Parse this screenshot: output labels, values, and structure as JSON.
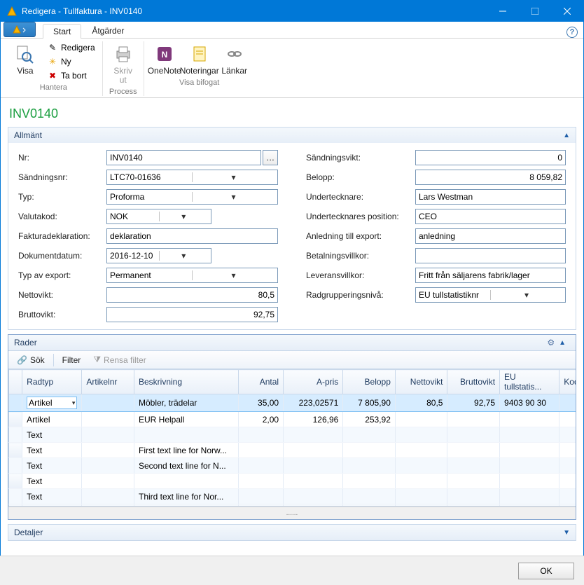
{
  "title": "Redigera - Tullfaktura - INV0140",
  "tabs": {
    "start": "Start",
    "actions": "Åtgärder"
  },
  "ribbon": {
    "visa": "Visa",
    "redigera": "Redigera",
    "ny": "Ny",
    "tabort": "Ta bort",
    "hantera": "Hantera",
    "skrivut_line1": "Skriv",
    "skrivut_line2": "ut",
    "process": "Process",
    "onenote": "OneNote",
    "noteringar": "Noteringar",
    "lankar": "Länkar",
    "visa_bifogat": "Visa bifogat"
  },
  "doc_title": "INV0140",
  "panels": {
    "allmant": "Allmänt",
    "rader": "Rader",
    "detaljer": "Detaljer"
  },
  "grid_toolbar": {
    "sok": "Sök",
    "filter": "Filter",
    "rensa": "Rensa filter"
  },
  "labels": {
    "nr": "Nr:",
    "sandningsnr": "Sändningsnr:",
    "typ": "Typ:",
    "valutakod": "Valutakod:",
    "fakturadeklaration": "Fakturadeklaration:",
    "dokumentdatum": "Dokumentdatum:",
    "typ_av_export": "Typ av export:",
    "nettovikt": "Nettovikt:",
    "bruttovikt": "Bruttovikt:",
    "sandningsvikt": "Sändningsvikt:",
    "belopp": "Belopp:",
    "undertecknare": "Undertecknare:",
    "undertecknares_position": "Undertecknares position:",
    "anledning_export": "Anledning till export:",
    "betalningsvillkor": "Betalningsvillkor:",
    "leveransvillkor": "Leveransvillkor:",
    "radgrupperingsniva": "Radgrupperingsnivå:"
  },
  "values": {
    "nr": "INV0140",
    "sandningsnr": "LTC70-01636",
    "typ": "Proforma",
    "valutakod": "NOK",
    "fakturadeklaration": "deklaration",
    "dokumentdatum": "2016-12-10",
    "typ_av_export": "Permanent",
    "nettovikt": "80,5",
    "bruttovikt": "92,75",
    "sandningsvikt": "0",
    "belopp": "8 059,82",
    "undertecknare": "Lars Westman",
    "undertecknares_position": "CEO",
    "anledning_export": "anledning",
    "betalningsvillkor": "",
    "leveransvillkor": "Fritt från säljarens fabrik/lager",
    "radgrupperingsniva": "EU tullstatistiknr"
  },
  "grid": {
    "headers": {
      "radtyp": "Radtyp",
      "artikelnr": "Artikelnr",
      "beskrivning": "Beskrivning",
      "antal": "Antal",
      "apris": "A-pris",
      "belopp": "Belopp",
      "nettovikt": "Nettovikt",
      "bruttovikt": "Bruttovikt",
      "eu": "EU tullstatis...",
      "kod": "Kod"
    },
    "rows": [
      {
        "radtyp": "Artikel",
        "artikelnr": "",
        "beskrivning": "Möbler, trädelar",
        "antal": "35,00",
        "apris": "223,02571",
        "belopp": "7 805,90",
        "nettovikt": "80,5",
        "bruttovikt": "92,75",
        "eu": "9403 90 30",
        "kod": ""
      },
      {
        "radtyp": "Artikel",
        "artikelnr": "",
        "beskrivning": "EUR Helpall",
        "antal": "2,00",
        "apris": "126,96",
        "belopp": "253,92",
        "nettovikt": "",
        "bruttovikt": "",
        "eu": "",
        "kod": ""
      },
      {
        "radtyp": "Text",
        "artikelnr": "",
        "beskrivning": "",
        "antal": "",
        "apris": "",
        "belopp": "",
        "nettovikt": "",
        "bruttovikt": "",
        "eu": "",
        "kod": ""
      },
      {
        "radtyp": "Text",
        "artikelnr": "",
        "beskrivning": "First text line for Norw...",
        "antal": "",
        "apris": "",
        "belopp": "",
        "nettovikt": "",
        "bruttovikt": "",
        "eu": "",
        "kod": ""
      },
      {
        "radtyp": "Text",
        "artikelnr": "",
        "beskrivning": "Second text line for N...",
        "antal": "",
        "apris": "",
        "belopp": "",
        "nettovikt": "",
        "bruttovikt": "",
        "eu": "",
        "kod": ""
      },
      {
        "radtyp": "Text",
        "artikelnr": "",
        "beskrivning": "",
        "antal": "",
        "apris": "",
        "belopp": "",
        "nettovikt": "",
        "bruttovikt": "",
        "eu": "",
        "kod": ""
      },
      {
        "radtyp": "Text",
        "artikelnr": "",
        "beskrivning": "Third text line for Nor...",
        "antal": "",
        "apris": "",
        "belopp": "",
        "nettovikt": "",
        "bruttovikt": "",
        "eu": "",
        "kod": ""
      }
    ]
  },
  "footer": {
    "ok": "OK"
  },
  "splitter": "......"
}
